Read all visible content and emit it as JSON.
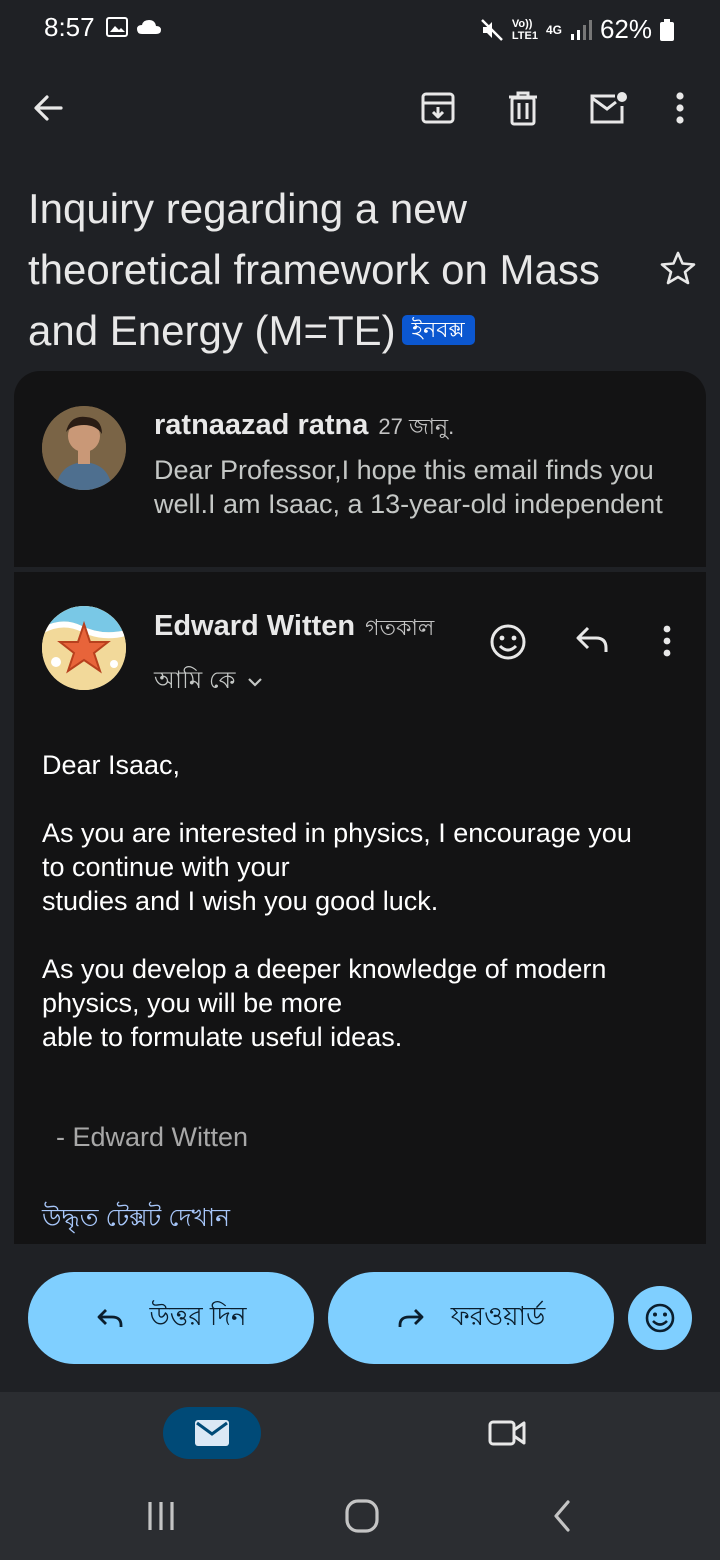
{
  "status_bar": {
    "time": "8:57",
    "net_volte": "Vo))",
    "net_lte": "LTE1",
    "net_4g": "4G",
    "battery": "62%"
  },
  "subject": {
    "text": "Inquiry regarding a new theoretical framework on Mass and Energy (M=TE)",
    "label": "ইনবক্স"
  },
  "message1": {
    "sender": "ratnaazad ratna",
    "date": "27 জানু.",
    "snippet_line1": "Dear Professor,I hope this email finds you",
    "snippet_line2": "well.I am Isaac, a 13-year-old independent"
  },
  "message2": {
    "sender": "Edward Witten",
    "date": "গতকাল",
    "recipient": "আমি কে",
    "body": {
      "greeting": "Dear Isaac,",
      "p1_line1": "As you are interested in physics, I encourage you",
      "p1_line2": "to continue with your",
      "p1_line3": "studies and I wish you good luck.",
      "p2_line1": "As you develop a deeper knowledge of modern",
      "p2_line2": "physics, you will be more",
      "p2_line3": "able to formulate useful ideas.",
      "signature": "- Edward Witten"
    },
    "show_quoted": "উদ্ধৃত টেক্সট দেখান"
  },
  "actions": {
    "reply": "উত্তর দিন",
    "forward": "ফরওয়ার্ড"
  },
  "colors": {
    "accent_pill": "#7fcfff",
    "link": "#a8c7fa",
    "badge": "#0b57d0"
  }
}
